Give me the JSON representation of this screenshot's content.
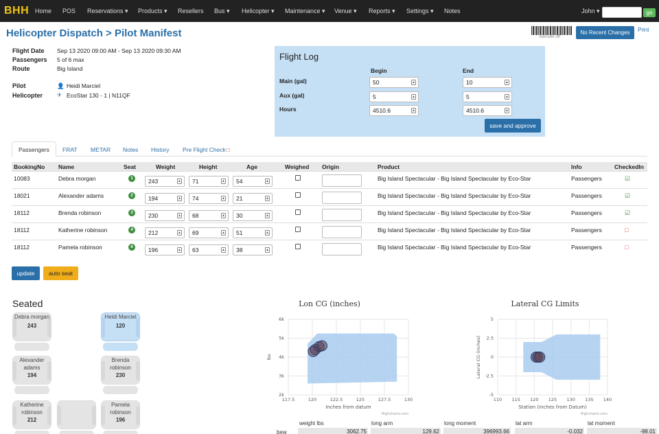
{
  "nav": {
    "brand": "BHH",
    "items": [
      "Home",
      "POS",
      "Reservations ▾",
      "Products ▾",
      "Resellers",
      "Bus ▾",
      "Helicopter ▾",
      "Maintenance ▾",
      "Venue ▾",
      "Reports ▾",
      "Settings ▾",
      "Notes"
    ],
    "user": "John ▾",
    "go": "go"
  },
  "page": {
    "title": "Helicopter Dispatch > Pilot Manifest",
    "barcode_label": "barcode off",
    "recent_button": "No Recent Changes",
    "print": "Print"
  },
  "flight": {
    "date_label": "Flight Date",
    "date": "Sep 13 2020 09:00 AM - Sep 13 2020 09:30 AM",
    "passengers_label": "Passengers",
    "passengers": "5 of 6 max",
    "route_label": "Route",
    "route": "Big Island",
    "pilot_label": "Pilot",
    "pilot": "Heidi Marciel",
    "helicopter_label": "Helicopter",
    "helicopter": "EcoStar 130 - 1 | N11QF"
  },
  "flight_log": {
    "title": "Flight Log",
    "begin": "Begin",
    "end": "End",
    "rows": [
      {
        "label": "Main (gal)",
        "begin": "50",
        "end": "10"
      },
      {
        "label": "Aux (gal)",
        "begin": "5",
        "end": "5"
      },
      {
        "label": "Hours",
        "begin": "4510.6",
        "end": "4510.6"
      }
    ],
    "save": "save and approve"
  },
  "tabs": [
    "Passengers",
    "FRAT",
    "METAR",
    "Notes",
    "History",
    "Pre Flight Check"
  ],
  "table": {
    "headers": [
      "BookingNo",
      "Name",
      "Seat",
      "Weight",
      "Height",
      "Age",
      "Weighed",
      "Origin",
      "Product",
      "Info",
      "CheckedIn"
    ],
    "rows": [
      {
        "booking": "10083",
        "name": "Debra morgan",
        "seat": "1",
        "weight": "243",
        "height": "71",
        "age": "54",
        "product": "Big Island Spectacular - Big Island Spectacular by Eco-Star",
        "info": "Passengers",
        "checked": true
      },
      {
        "booking": "18021",
        "name": "Alexander adams",
        "seat": "2",
        "weight": "194",
        "height": "74",
        "age": "21",
        "product": "Big Island Spectacular - Big Island Spectacular by Eco-Star",
        "info": "Passengers",
        "checked": true
      },
      {
        "booking": "18112",
        "name": "Brenda robinson",
        "seat": "3",
        "weight": "230",
        "height": "68",
        "age": "30",
        "product": "Big Island Spectacular - Big Island Spectacular by Eco-Star",
        "info": "Passengers",
        "checked": true
      },
      {
        "booking": "18112",
        "name": "Katherine robinson",
        "seat": "4",
        "weight": "212",
        "height": "69",
        "age": "51",
        "product": "Big Island Spectacular - Big Island Spectacular by Eco-Star",
        "info": "Passengers",
        "checked": false
      },
      {
        "booking": "18112",
        "name": "Pamela robinson",
        "seat": "6",
        "weight": "196",
        "height": "63",
        "age": "38",
        "product": "Big Island Spectacular - Big Island Spectacular by Eco-Star",
        "info": "Passengers",
        "checked": false
      }
    ]
  },
  "buttons": {
    "update": "update",
    "auto_seat": "auto seat"
  },
  "seated": {
    "title": "Seated",
    "seats": [
      {
        "name": "Debra morgan",
        "weight": "243"
      },
      {
        "name": "Heidi Marciel",
        "weight": "120"
      },
      {
        "name": "Alexander adams",
        "weight": "194"
      },
      {
        "name": "Brenda robinson",
        "weight": "230"
      },
      {
        "name": "Katherine robinson",
        "weight": "212"
      },
      {
        "name": "",
        "weight": ""
      },
      {
        "name": "Pamela robinson",
        "weight": "196"
      }
    ]
  },
  "chart_data": [
    {
      "type": "scatter",
      "title": "Lon CG (inches)",
      "xlabel": "Inches from datum",
      "ylabel": "lbs",
      "xlim": [
        117.5,
        130
      ],
      "ylim": [
        2000,
        6000
      ],
      "xticks": [
        "117.5",
        "120",
        "122.5",
        "125",
        "127.5",
        "130"
      ],
      "yticks": [
        "2k",
        "3k",
        "4k",
        "5k",
        "6k"
      ],
      "envelope": [
        [
          119.5,
          2600
        ],
        [
          119.5,
          4700
        ],
        [
          120.5,
          5250
        ],
        [
          128.5,
          5250
        ],
        [
          128.8,
          5100
        ],
        [
          128.8,
          2700
        ],
        [
          119.5,
          2600
        ]
      ],
      "points": [
        [
          120.3,
          4400
        ],
        [
          120.7,
          4550
        ],
        [
          121.0,
          4600
        ],
        [
          120.1,
          4300
        ]
      ],
      "credit": "Highcharts.com"
    },
    {
      "type": "scatter",
      "title": "Lateral CG Limits",
      "xlabel": "Station (inches from Datum)",
      "ylabel": "Lateral CG (inches)",
      "xlim": [
        110,
        140
      ],
      "ylim": [
        -5,
        5
      ],
      "xticks": [
        "110",
        "115",
        "120",
        "125",
        "130",
        "135",
        "140"
      ],
      "yticks": [
        "-5",
        "-2.5",
        "0",
        "2.5",
        "5"
      ],
      "envelope": [
        [
          117,
          -2
        ],
        [
          117,
          2
        ],
        [
          122,
          2
        ],
        [
          126,
          3
        ],
        [
          138,
          3
        ],
        [
          138,
          -3
        ],
        [
          126,
          -3
        ],
        [
          122,
          -2
        ],
        [
          117,
          -2
        ]
      ],
      "points": [
        [
          120.5,
          0
        ],
        [
          121.0,
          0
        ],
        [
          121.5,
          0
        ]
      ],
      "credit": "Highcharts.com"
    }
  ],
  "balance": {
    "headers": [
      "weight lbs",
      "long arm",
      "long moment",
      "lat arm",
      "lat moment"
    ],
    "row_label": "bew",
    "values": [
      "3062.75",
      "129.62",
      "396993.66",
      "-0.032",
      "-98.01"
    ]
  }
}
